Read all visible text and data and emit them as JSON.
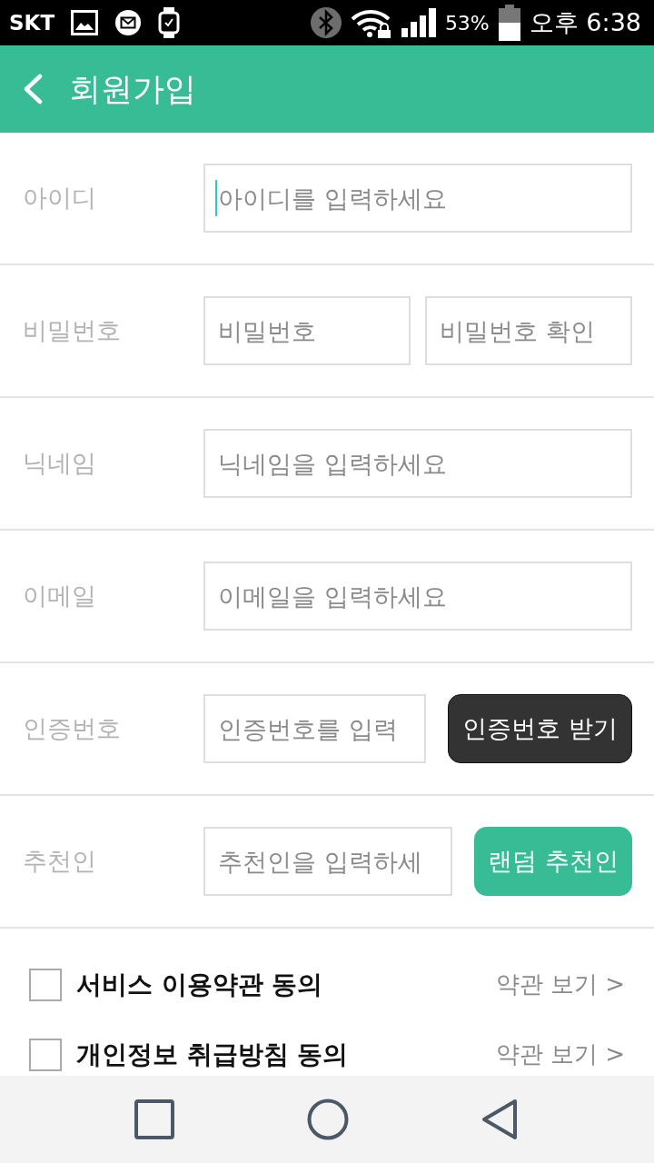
{
  "status_bar": {
    "carrier": "SKT",
    "battery": "53%",
    "time": "오후 6:38"
  },
  "header": {
    "title": "회원가입"
  },
  "form": {
    "rows": [
      {
        "kind": "single",
        "label": "아이디",
        "fields": [
          {
            "placeholder": "아이디를 입력하세요",
            "focused": true
          }
        ]
      },
      {
        "kind": "pair",
        "label": "비밀번호",
        "fields": [
          {
            "placeholder": "비밀번호",
            "focused": false
          },
          {
            "placeholder": "비밀번호 확인",
            "focused": false
          }
        ]
      },
      {
        "kind": "single",
        "label": "닉네임",
        "fields": [
          {
            "placeholder": "닉네임을 입력하세요",
            "focused": false
          }
        ]
      },
      {
        "kind": "single",
        "label": "이메일",
        "fields": [
          {
            "placeholder": "이메일을 입력하세요",
            "focused": false
          }
        ]
      },
      {
        "kind": "request",
        "label": "인증번호",
        "fields": [
          {
            "placeholder": "인증번호를 입력",
            "focused": false
          }
        ],
        "button": {
          "label": "인증번호 받기"
        }
      },
      {
        "kind": "random",
        "label": "추천인",
        "fields": [
          {
            "placeholder": "추천인을 입력하세",
            "focused": false
          }
        ],
        "button": {
          "label": "랜덤 추천인"
        }
      }
    ]
  },
  "agreements": [
    {
      "label": "서비스 이용약관 동의",
      "checked": false,
      "link": "약관 보기 >"
    },
    {
      "label": "개인정보 취급방침 동의",
      "checked": false,
      "link": "약관 보기 >"
    }
  ]
}
